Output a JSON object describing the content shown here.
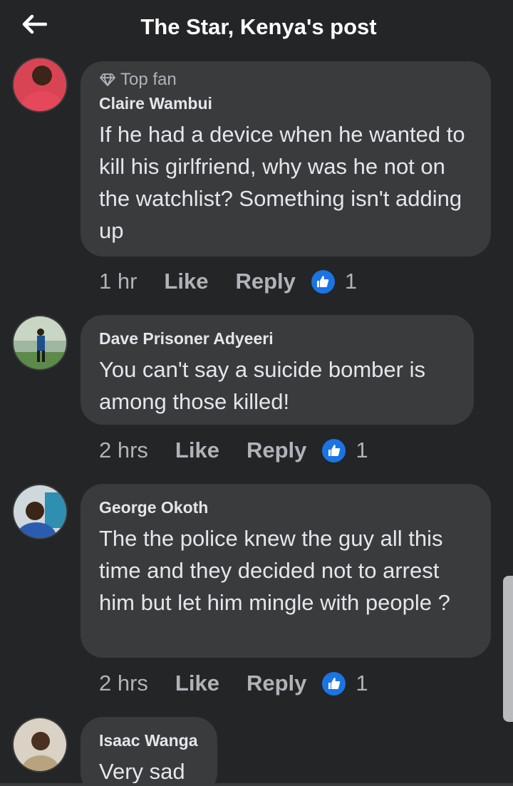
{
  "header": {
    "title": "The Star, Kenya's post",
    "back_icon": "arrow-left-icon"
  },
  "comments": [
    {
      "badge": "Top fan",
      "author": "Claire Wambui",
      "text": "If he had a device when he wanted to kill his girlfriend, why was he not on the watchlist? Something isn't adding up",
      "time": "1 hr",
      "like_label": "Like",
      "reply_label": "Reply",
      "reactions": "1"
    },
    {
      "author": "Dave Prisoner Adyeeri",
      "text": "You can't say a suicide bomber is among those killed!",
      "time": "2 hrs",
      "like_label": "Like",
      "reply_label": "Reply",
      "reactions": "1"
    },
    {
      "author": "George Okoth",
      "text": "The the police knew the guy all this time and they decided not to arrest him but let him mingle with people ?",
      "time": "2 hrs",
      "like_label": "Like",
      "reply_label": "Reply",
      "reactions": "1"
    },
    {
      "author": "Isaac Wanga",
      "text": "Very sad"
    }
  ],
  "colors": {
    "background": "#242526",
    "bubble": "#3a3b3c",
    "like_blue": "#1b74e4"
  }
}
